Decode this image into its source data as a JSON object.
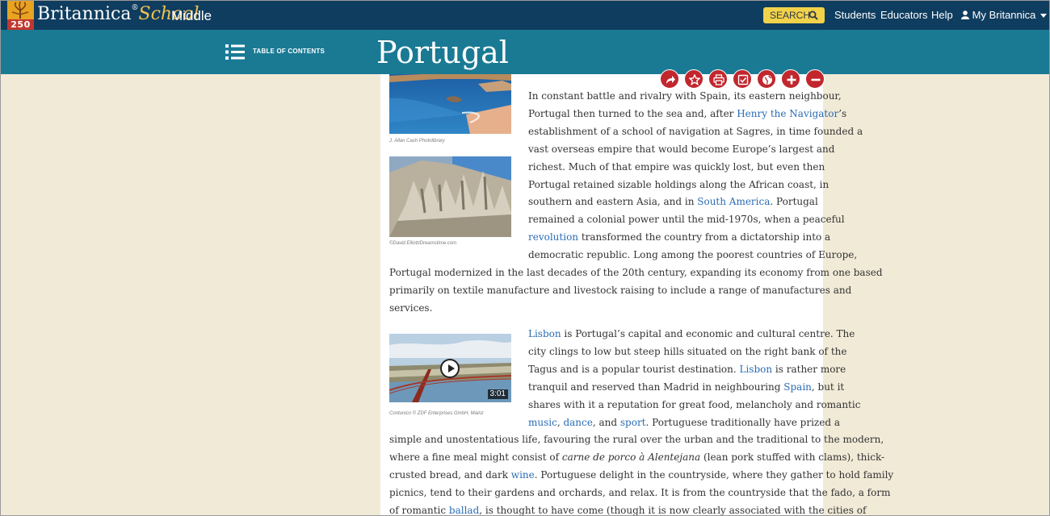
{
  "header": {
    "badge_number": "250",
    "brand_main": "Britannica",
    "brand_school": "School",
    "brand_level": "Middle",
    "search_label": "SEARCH",
    "nav": [
      "Students",
      "Educators",
      "Help",
      "My Britannica"
    ]
  },
  "titlebar": {
    "toc_label": "TABLE OF CONTENTS",
    "title": "Portugal"
  },
  "tools": [
    "share-icon",
    "star-icon",
    "print-icon",
    "checklist-icon",
    "translate-icon",
    "plus-icon",
    "minus-icon"
  ],
  "colors": {
    "topbar": "#0f3d5f",
    "titlebar": "#1a7a94",
    "page_bg": "#f1ead7",
    "link": "#2a6cb5",
    "tool_red": "#c1272d",
    "search_yellow": "#f2d24b"
  },
  "media": [
    {
      "credit": "J. Allan Cash Photolibrary"
    },
    {
      "credit": "©David Elliott/Dreamstime.com"
    },
    {
      "credit": "Contunico © ZDF Enterprises GmbH, Mainz",
      "duration": "3:01"
    }
  ],
  "article": {
    "paragraph1": [
      [
        {
          "t": "In constant battle and rivalry with Spain, its eastern neighbour,"
        }
      ],
      [
        {
          "t": "Portugal then turned to the sea and, after "
        },
        {
          "t": "Henry the Navigator",
          "link": true
        },
        {
          "t": "’s"
        }
      ],
      [
        {
          "t": "establishment of a school of navigation at Sagres, in time founded a"
        }
      ],
      [
        {
          "t": "vast overseas empire that would become Europe’s largest and"
        }
      ],
      [
        {
          "t": "richest. Much of that empire was quickly lost, but even then"
        }
      ],
      [
        {
          "t": "Portugal retained sizable holdings along the African coast, in"
        }
      ],
      [
        {
          "t": "southern and eastern Asia, and in "
        },
        {
          "t": "South America",
          "link": true
        },
        {
          "t": ". Portugal"
        }
      ],
      [
        {
          "t": "remained a colonial power until the mid-1970s, when a peaceful"
        }
      ],
      [
        {
          "t": "revolution",
          "link": true
        },
        {
          "t": " transformed the country from a dictatorship into a"
        }
      ],
      [
        {
          "t": "democratic republic. Long among the poorest countries of Europe,"
        }
      ],
      [
        {
          "t": "Portugal modernized in the last decades of the 20th century, expanding its economy from one based"
        }
      ],
      [
        {
          "t": "primarily on textile manufacture and livestock raising to include a range of manufactures and"
        }
      ],
      [
        {
          "t": "services."
        }
      ]
    ],
    "paragraph2": [
      [
        {
          "t": "Lisbon",
          "link": true
        },
        {
          "t": " is Portugal’s capital and economic and cultural centre. The"
        }
      ],
      [
        {
          "t": "city clings to low but steep hills situated on the right bank of the"
        }
      ],
      [
        {
          "t": "Tagus and is a popular tourist destination. "
        },
        {
          "t": "Lisbon",
          "link": true
        },
        {
          "t": " is rather more"
        }
      ],
      [
        {
          "t": "tranquil and reserved than Madrid in neighbouring "
        },
        {
          "t": "Spain",
          "link": true
        },
        {
          "t": ", but it"
        }
      ],
      [
        {
          "t": "shares with it a reputation for great food, melancholy and romantic"
        }
      ],
      [
        {
          "t": "music",
          "link": true
        },
        {
          "t": ", "
        },
        {
          "t": "dance",
          "link": true
        },
        {
          "t": ", and "
        },
        {
          "t": "sport",
          "link": true
        },
        {
          "t": ". Portuguese traditionally have prized a"
        }
      ],
      [
        {
          "t": "simple and unostentatious life, favouring the rural over the urban and the traditional to the modern,"
        }
      ],
      [
        {
          "t": "where a fine meal might consist of "
        },
        {
          "t": "carne de porco à Alentejana",
          "em": true
        },
        {
          "t": " (lean pork stuffed with clams), thick-"
        }
      ],
      [
        {
          "t": "crusted bread, and dark "
        },
        {
          "t": "wine",
          "link": true
        },
        {
          "t": ". Portuguese delight in the countryside, where they gather to hold family"
        }
      ],
      [
        {
          "t": "picnics, tend to their gardens and orchards, and relax. It is from the countryside that the fado, a form"
        }
      ],
      [
        {
          "t": "of romantic "
        },
        {
          "t": "ballad",
          "link": true
        },
        {
          "t": ", is thought to have come (though it is now clearly associated with the cities of"
        }
      ]
    ]
  }
}
